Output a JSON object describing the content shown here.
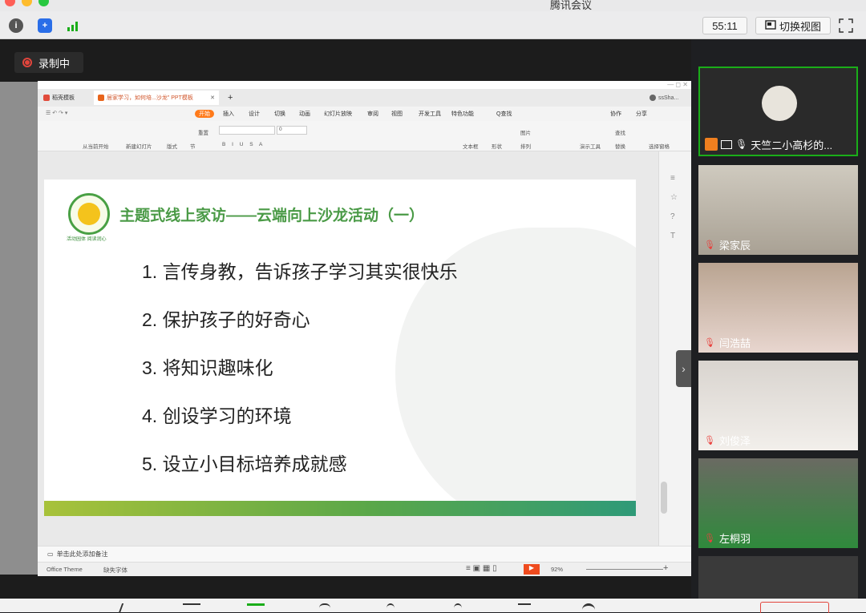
{
  "app": {
    "title": "腾讯会议"
  },
  "toolbar": {
    "timer": "55:11",
    "switch_view_label": "切换视图"
  },
  "recording": {
    "label": "录制中"
  },
  "wps": {
    "tabs": [
      {
        "label": "稻壳模板"
      },
      {
        "label": "居家学习，如何培...沙龙\" PPT模板"
      }
    ],
    "user": "ssSha...",
    "menu": [
      "开始",
      "插入",
      "设计",
      "切换",
      "动画",
      "幻灯片放映",
      "审阅",
      "视图",
      "开发工具",
      "特色功能",
      "Q查找"
    ],
    "menu_right": [
      "协作",
      "分享"
    ],
    "ribbon": [
      "从当前开始",
      "新建幻灯片",
      "版式",
      "节",
      "重置",
      "文本框",
      "形状",
      "图片",
      "排列",
      "演示工具",
      "查找",
      "替换",
      "选择窗格"
    ],
    "font_size": "0",
    "notes_placeholder": "单击此处添加备注",
    "status": {
      "theme": "Office Theme",
      "font_missing": "缺失字体",
      "zoom": "92%"
    }
  },
  "slide": {
    "title": "主题式线上家访——云端向上沙龙活动（一）",
    "logo_caption": "活动园体 阅读润心",
    "items": [
      "1. 言传身教，告诉孩子学习其实很快乐",
      "2. 保护孩子的好奇心",
      "3. 将知识趣味化",
      "4. 创设学习的环境",
      "5. 设立小目标培养成就感"
    ]
  },
  "participants": [
    {
      "name": "天竺二小高杉的...",
      "active": true
    },
    {
      "name": "梁家辰",
      "active": false
    },
    {
      "name": "闫浩喆",
      "active": false
    },
    {
      "name": "刘俊泽",
      "active": false
    },
    {
      "name": "左桐羽",
      "active": false
    }
  ]
}
